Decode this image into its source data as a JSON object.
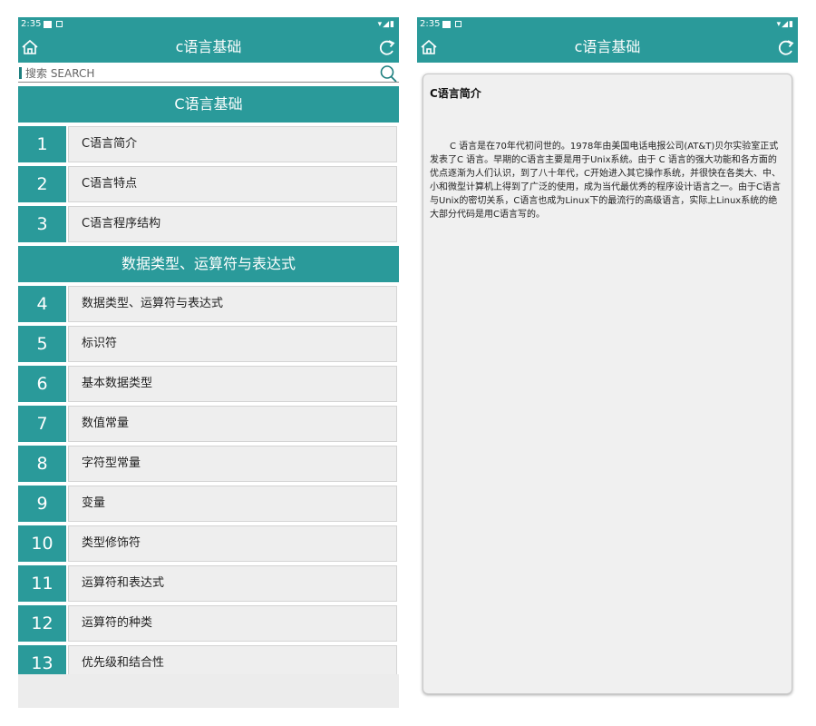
{
  "left": {
    "status": {
      "time": "2:35"
    },
    "appbar": {
      "title": "c语言基础"
    },
    "search": {
      "placeholder": "搜索 SEARCH"
    },
    "list": {
      "section1": "C语言基础",
      "section2": "数据类型、运算符与表达式",
      "items1": [
        {
          "num": "1",
          "label": "C语言简介"
        },
        {
          "num": "2",
          "label": "C语言特点"
        },
        {
          "num": "3",
          "label": "C语言程序结构"
        }
      ],
      "items2": [
        {
          "num": "4",
          "label": "数据类型、运算符与表达式"
        },
        {
          "num": "5",
          "label": "标识符"
        },
        {
          "num": "6",
          "label": "基本数据类型"
        },
        {
          "num": "7",
          "label": "数值常量"
        },
        {
          "num": "8",
          "label": "字符型常量"
        },
        {
          "num": "9",
          "label": "变量"
        },
        {
          "num": "10",
          "label": "类型修饰符"
        },
        {
          "num": "11",
          "label": "运算符和表达式"
        },
        {
          "num": "12",
          "label": "运算符的种类"
        },
        {
          "num": "13",
          "label": "优先级和结合性"
        }
      ]
    }
  },
  "right": {
    "status": {
      "time": "2:35"
    },
    "appbar": {
      "title": "c语言基础"
    },
    "detail": {
      "title": "C语言简介",
      "body": "C 语言是在70年代初问世的。1978年由美国电话电报公司(AT&T)贝尔实验室正式发表了C 语言。早期的C语言主要是用于Unix系统。由于 C 语言的强大功能和各方面的优点逐渐为人们认识，到了八十年代，C开始进入其它操作系统，并很快在各类大、中、小和微型计算机上得到了广泛的使用，成为当代最优秀的程序设计语言之一。由于C语言与Unix的密切关系，C语言也成为Linux下的最流行的高级语言，实际上Linux系统的绝大部分代码是用C语言写的。"
    }
  },
  "colors": {
    "accent": "#2a9a9a",
    "row_bg": "#eeeeee",
    "card_bg": "#f0f0f0"
  },
  "icons": [
    "home-icon",
    "refresh-icon",
    "search-icon",
    "wifi-icon",
    "signal-icon",
    "battery-icon"
  ]
}
